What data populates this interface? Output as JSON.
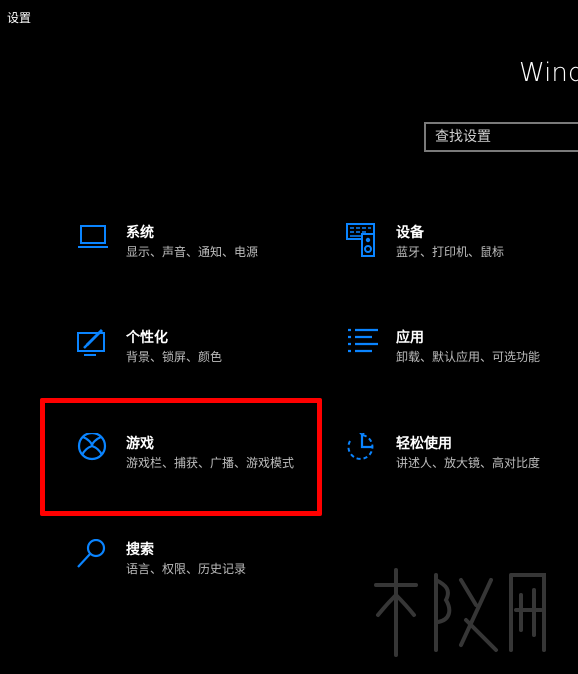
{
  "window": {
    "title": "设置",
    "heading": "Windo"
  },
  "search": {
    "placeholder": "查找设置"
  },
  "tiles": [
    {
      "title": "系统",
      "desc": "显示、声音、通知、电源",
      "icon": "laptop-icon"
    },
    {
      "title": "设备",
      "desc": "蓝牙、打印机、鼠标",
      "icon": "devices-icon"
    },
    {
      "title": "个性化",
      "desc": "背景、锁屏、颜色",
      "icon": "personalization-icon"
    },
    {
      "title": "应用",
      "desc": "卸载、默认应用、可选功能",
      "icon": "apps-icon"
    },
    {
      "title": "游戏",
      "desc": "游戏栏、捕获、广播、游戏模式",
      "icon": "xbox-icon"
    },
    {
      "title": "轻松使用",
      "desc": "讲述人、放大镜、高对比度",
      "icon": "ease-of-access-icon"
    },
    {
      "title": "搜索",
      "desc": "语言、权限、历史记录",
      "icon": "search-icon"
    }
  ],
  "colors": {
    "accent": "#0a84ff",
    "highlight": "#ff0000",
    "background": "#000000"
  }
}
